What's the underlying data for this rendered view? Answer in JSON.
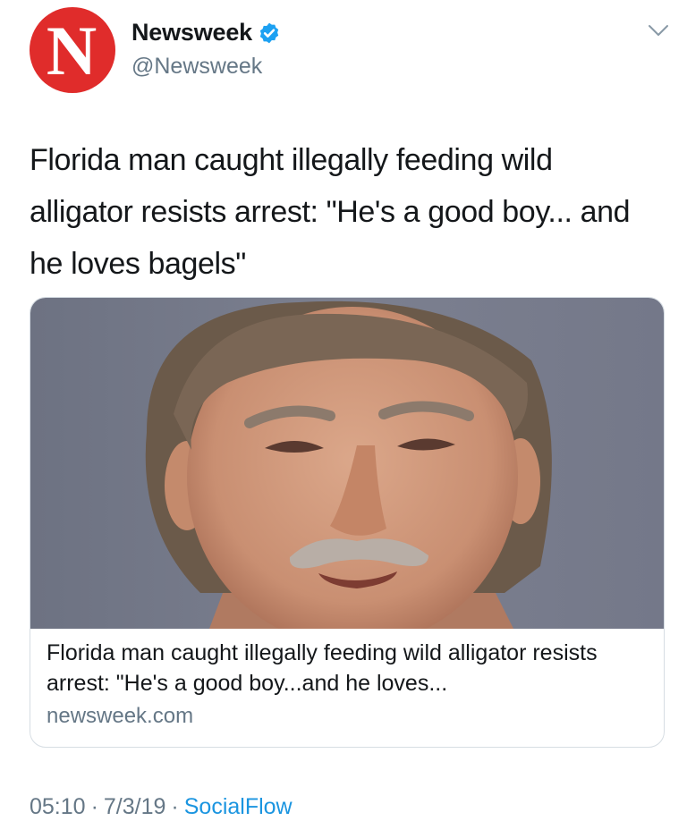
{
  "header": {
    "avatar_letter": "N",
    "display_name": "Newsweek",
    "handle": "@Newsweek"
  },
  "tweet": {
    "text": "Florida man caught illegally feeding wild alligator resists arrest: \"He's a good boy... and he loves bagels\""
  },
  "card": {
    "title": "Florida man caught illegally feeding wild alligator resists arrest: \"He's a good boy...and he loves...",
    "domain": "newsweek.com"
  },
  "meta": {
    "time": "05:10",
    "separator": "·",
    "date": "7/3/19",
    "source": "SocialFlow"
  },
  "colors": {
    "brand_red": "#e02c2b",
    "verified_blue": "#1da1f2",
    "link_blue": "#1b95e0",
    "secondary_text": "#657786"
  },
  "icons": [
    "verified-badge-icon",
    "chevron-down-icon"
  ]
}
